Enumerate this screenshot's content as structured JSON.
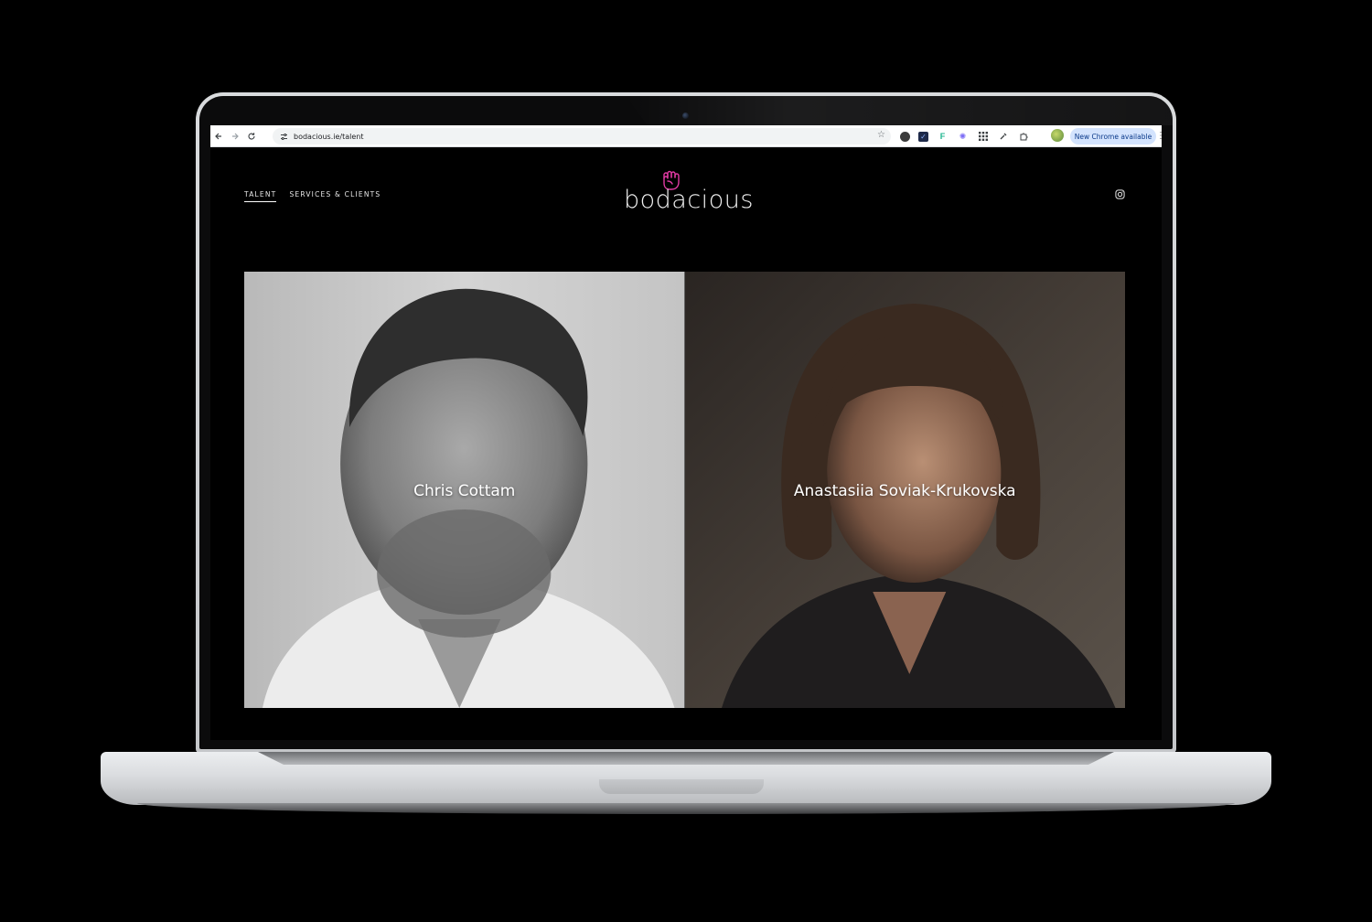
{
  "browser": {
    "url": "bodacious.ie/talent",
    "update_label": "New Chrome available"
  },
  "site": {
    "brand": "bodacious",
    "brand_accent_color": "#e23aa4",
    "nav": [
      {
        "label": "TALENT",
        "active": true
      },
      {
        "label": "SERVICES & CLIENTS",
        "active": false
      }
    ],
    "social_icon": "instagram-icon",
    "talent": [
      {
        "name": "Chris Cottam",
        "photo_style": "black-and-white"
      },
      {
        "name": "Anastasiia Soviak-Krukovska",
        "photo_style": "color"
      }
    ]
  }
}
